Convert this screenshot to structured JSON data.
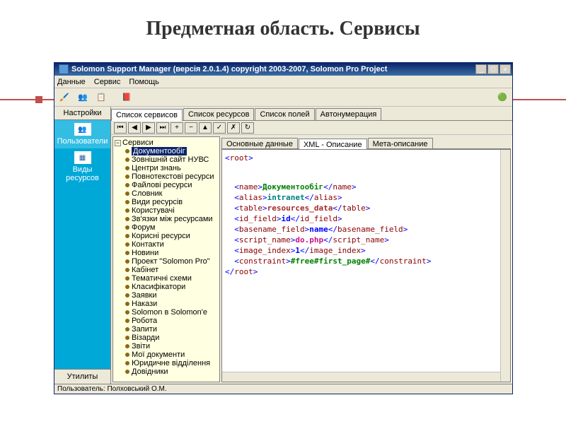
{
  "slide_title": "Предметная область. Сервисы",
  "window_title": "Solomon Support Manager (версія 2.0.1.4) copyright 2003-2007, Solomon Pro Project",
  "menubar": [
    "Данные",
    "Сервис",
    "Помощь"
  ],
  "left_panel": {
    "settings": "Настройки",
    "buttons": [
      {
        "label": "Пользователи",
        "icon": "👥"
      },
      {
        "label": "Виды ресурсов",
        "icon": "▦"
      }
    ],
    "utility": "Утилиты"
  },
  "main_tabs": [
    "Список сервисов",
    "Список ресурсов",
    "Список полей",
    "Автонумерация"
  ],
  "main_tab_active": 0,
  "nav_buttons": [
    "⏮",
    "◀",
    "▶",
    "⏭",
    "+",
    "−",
    "▲",
    "✓",
    "✗",
    "↻"
  ],
  "tree": {
    "root_label": "Сервиси",
    "items": [
      "Документообіг",
      "Зовнішній сайт НУВС",
      "Центри знань",
      "Повнотекстові ресурси",
      "Файлові ресурси",
      "Словник",
      "Види ресурсів",
      "Користувачі",
      "Зв'язки між ресурсами",
      "Форум",
      "Корисні ресурси",
      "Контакти",
      "Новини",
      "Проект \"Solomon Pro\"",
      "Кабінет",
      "Тематичні схеми",
      "Класифікатори",
      "Заявки",
      "Накази",
      "Solomon в Solomon'е",
      "Робота",
      "Запити",
      "Візарди",
      "Звіти",
      "Мої документи",
      "Юридичне відділення",
      "Довідники"
    ],
    "selected": 0
  },
  "sub_tabs": [
    "Основные данные",
    "XML - Описание",
    "Мета-описание"
  ],
  "sub_tab_active": 1,
  "xml": {
    "root_tag": "root",
    "fields": [
      {
        "tag": "name",
        "value": "Документообіг",
        "cls": "xml-val-green"
      },
      {
        "tag": "alias",
        "value": "intranet",
        "cls": "xml-val-teal"
      },
      {
        "tag": "table",
        "value": "resources_data",
        "cls": "xml-val-red"
      },
      {
        "tag": "id_field",
        "value": "id",
        "cls": "xml-val-blue"
      },
      {
        "tag": "basename_field",
        "value": "name",
        "cls": "xml-val-blue"
      },
      {
        "tag": "script_name",
        "value": "do.php",
        "cls": "xml-val-pink"
      },
      {
        "tag": "image_index",
        "value": "1",
        "cls": "xml-val-blue"
      },
      {
        "tag": "constraint",
        "value": "#free#first_page#",
        "cls": "xml-val-green"
      }
    ]
  },
  "statusbar": "Пользователь: Полховський О.М."
}
